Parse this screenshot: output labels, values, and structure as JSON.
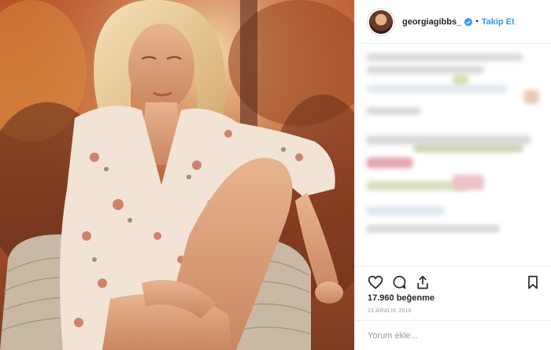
{
  "header": {
    "username": "georgiagibbs_",
    "separator": "•",
    "follow_label": "Takip Et"
  },
  "stats": {
    "likes": "17.960 beğenme",
    "date": "21 ARALIK 2018"
  },
  "comment": {
    "placeholder": "Yorum ekle..."
  },
  "icons": {
    "like": "heart-icon",
    "comment": "comment-icon",
    "share": "share-icon",
    "save": "bookmark-icon",
    "verified": "verified-badge-icon"
  },
  "colors": {
    "accent": "#3897f0",
    "text": "#262626",
    "muted": "#999999",
    "border": "#efefef"
  }
}
